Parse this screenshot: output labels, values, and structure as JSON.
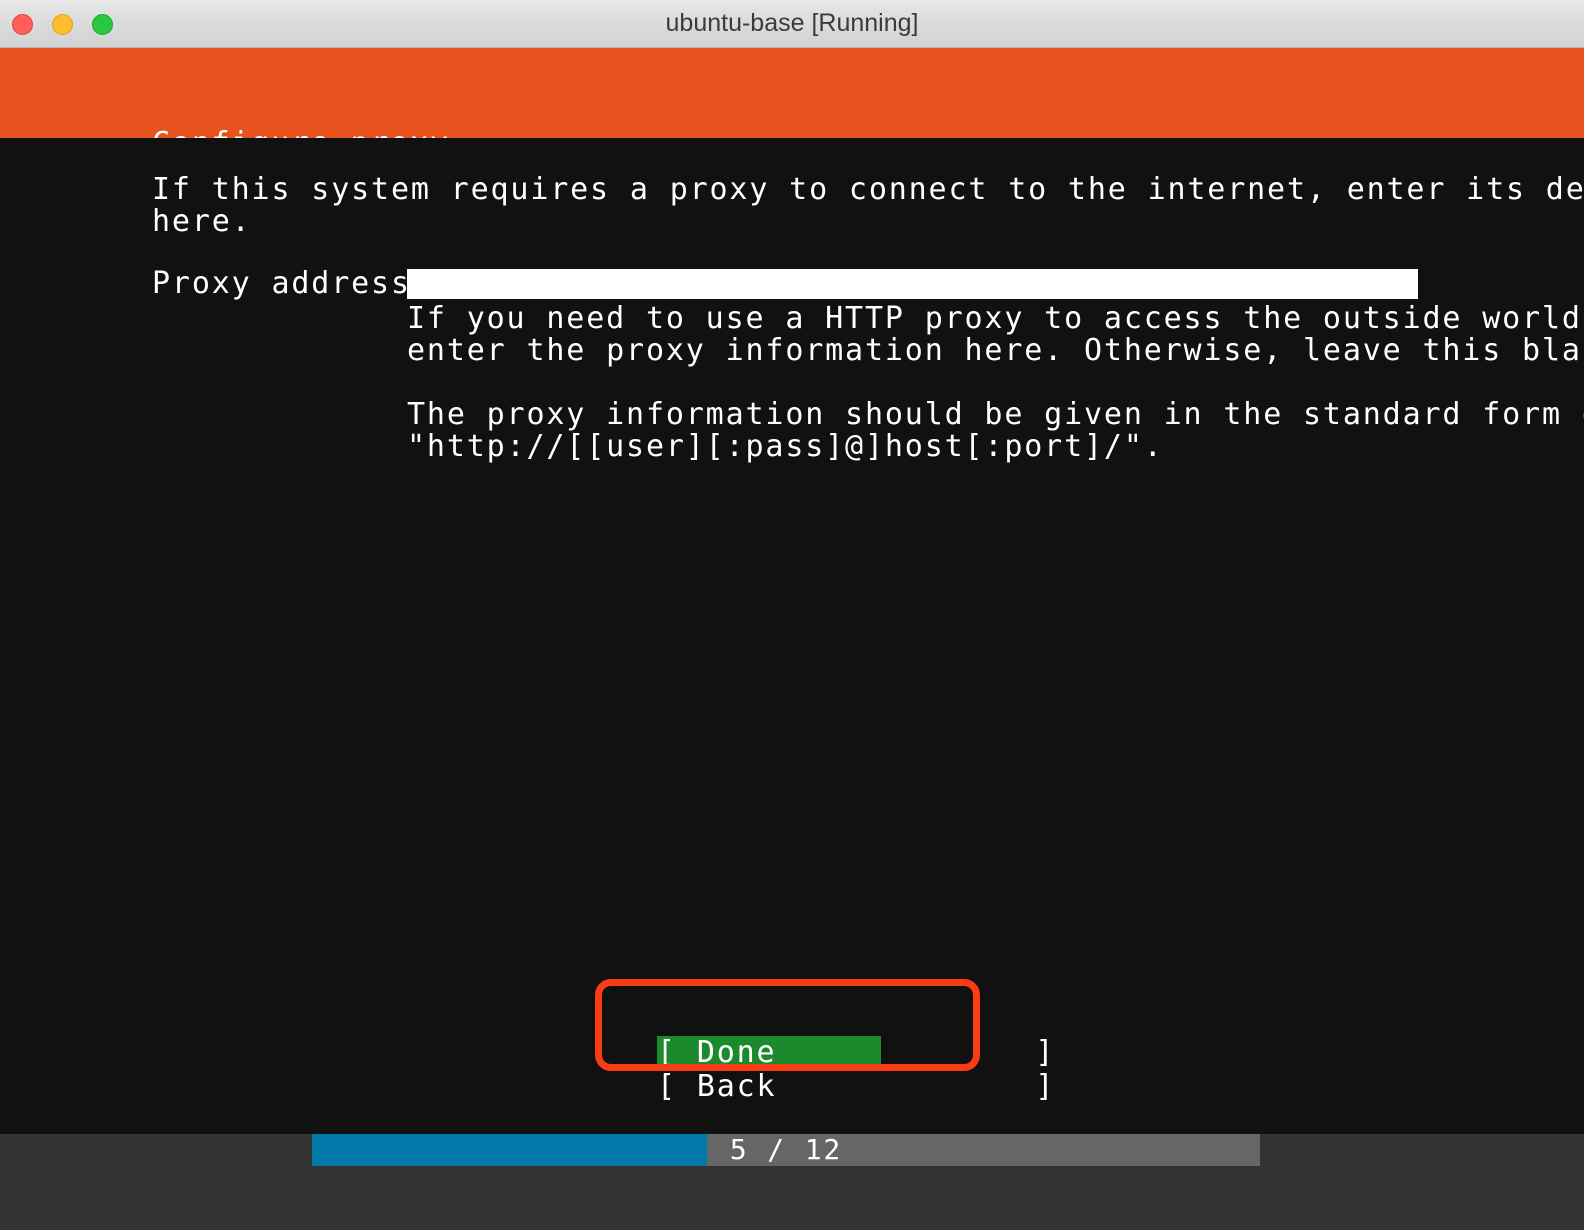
{
  "window": {
    "title": "ubuntu-base [Running]",
    "controls": {
      "close": "close-button",
      "minimize": "minimize-button",
      "maximize": "maximize-button"
    }
  },
  "header": {
    "title": "Configure proxy",
    "background_color": "#e8521f"
  },
  "main": {
    "intro_line_1": "If this system requires a proxy to connect to the internet, enter its details",
    "intro_line_2": "here.",
    "proxy_label": "Proxy address:",
    "proxy_value": "",
    "proxy_placeholder": "",
    "help_line_1": "If you need to use a HTTP proxy to access the outside world,",
    "help_line_2": "enter the proxy information here. Otherwise, leave this blank.",
    "help_line_3": "The proxy information should be given in the standard form of",
    "help_line_4": "\"http://[[user][:pass]@]host[:port]/\"."
  },
  "buttons": {
    "done": "[ Done             ]",
    "back": "[ Back             ]",
    "done_selected": true,
    "done_highlight_color": "#1a8a2c",
    "annotation_color": "#fa3c14"
  },
  "footer": {
    "progress_text": "5 / 12",
    "current_step": 5,
    "total_steps": 12,
    "fill_color": "#0079a8",
    "track_color": "#666666"
  }
}
